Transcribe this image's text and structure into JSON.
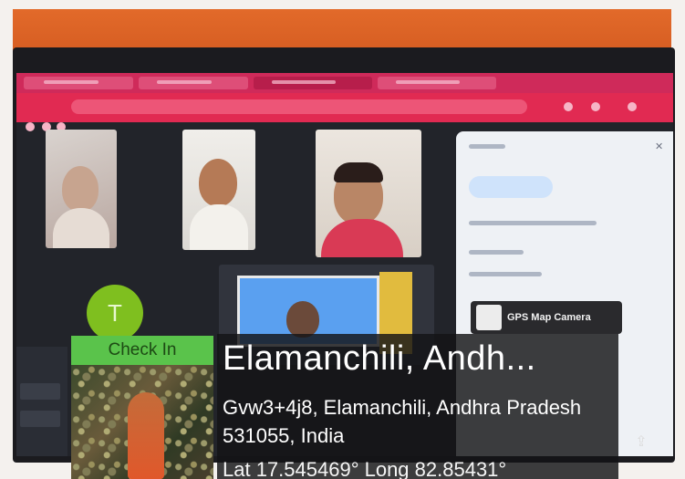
{
  "camera_app": {
    "name": "GPS Map Camera"
  },
  "meeting": {
    "participant_initial": "T",
    "check_in_label": "Check In"
  },
  "location": {
    "place": "Elamanchili, Andh...",
    "address": "Gvw3+4j8, Elamanchili, Andhra Pradesh 531055, India",
    "coordinates": "Lat 17.545469° Long 82.85431°"
  },
  "colors": {
    "accent_green": "#5ac34b",
    "browser_bar": "#cf2a5a",
    "wall": "#e26a2a"
  },
  "icons": {
    "gps_logo": "map-pin-icon",
    "upload": "upload-icon"
  }
}
